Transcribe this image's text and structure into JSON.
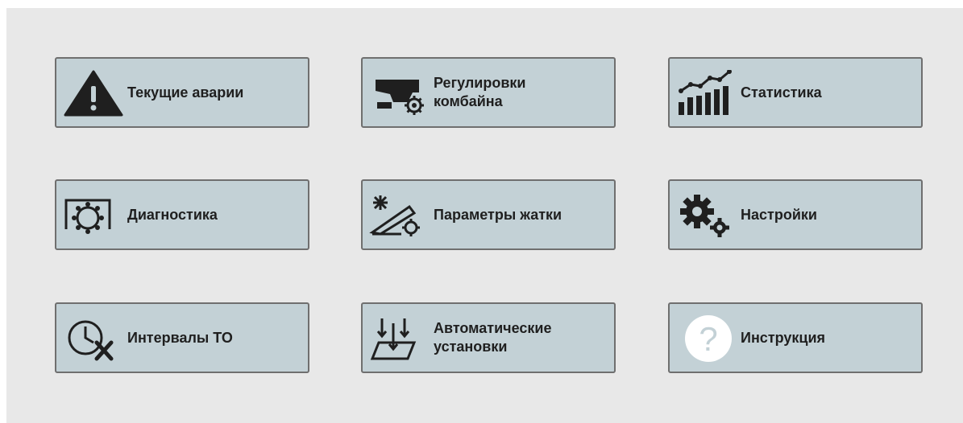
{
  "menu": {
    "tiles": [
      {
        "label": "Текущие аварии",
        "icon": "warning-triangle-icon"
      },
      {
        "label_line1": "Регулировки",
        "label_line2": "комбайна",
        "icon": "combine-settings-icon"
      },
      {
        "label": "Статистика",
        "icon": "statistics-chart-icon"
      },
      {
        "label": "Диагностика",
        "icon": "diagnostics-gear-icon"
      },
      {
        "label": "Параметры жатки",
        "icon": "header-parameters-icon"
      },
      {
        "label": "Настройки",
        "icon": "settings-gears-icon"
      },
      {
        "label": "Интервалы ТО",
        "icon": "maintenance-clock-icon"
      },
      {
        "label_line1": "Автоматические",
        "label_line2": "установки",
        "icon": "automatic-setup-icon"
      },
      {
        "label": "Инструкция",
        "icon": "help-question-icon"
      }
    ]
  },
  "colors": {
    "background": "#e8e8e8",
    "tile": "#c3d1d6",
    "tile_border": "#6f6f6f",
    "icon": "#1f1f1f",
    "text": "#1f1f1f"
  }
}
